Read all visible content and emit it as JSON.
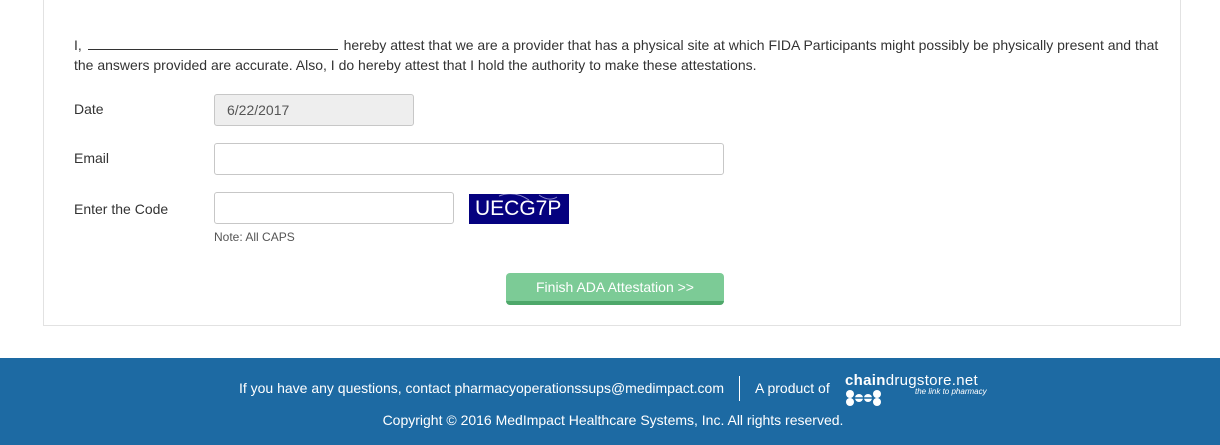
{
  "attestation": {
    "prefix": "I,",
    "text": "hereby attest that we are a provider that has a physical site at which FIDA Participants might possibly be physically present and that the answers provided are accurate. Also, I do hereby attest that I hold the authority to make these attestations."
  },
  "form": {
    "date_label": "Date",
    "date_value": "6/22/2017",
    "email_label": "Email",
    "email_value": "",
    "code_label": "Enter the Code",
    "code_value": "",
    "code_note": "Note: All CAPS",
    "captcha_text": "UECG7P",
    "submit_label": "Finish ADA Attestation >>"
  },
  "footer": {
    "contact_text": "If you have any questions, contact pharmacyoperationssups@medimpact.com",
    "product_text": "A product of",
    "logo_brand_bold": "chain",
    "logo_brand_rest": "drugstore.net",
    "logo_tagline": "the link to pharmacy",
    "copyright": "Copyright © 2016 MedImpact Healthcare Systems, Inc. All rights reserved."
  },
  "colors": {
    "footer_bg": "#1d6aa3",
    "button_bg": "#7ccb96",
    "captcha_bg": "#05017f"
  }
}
